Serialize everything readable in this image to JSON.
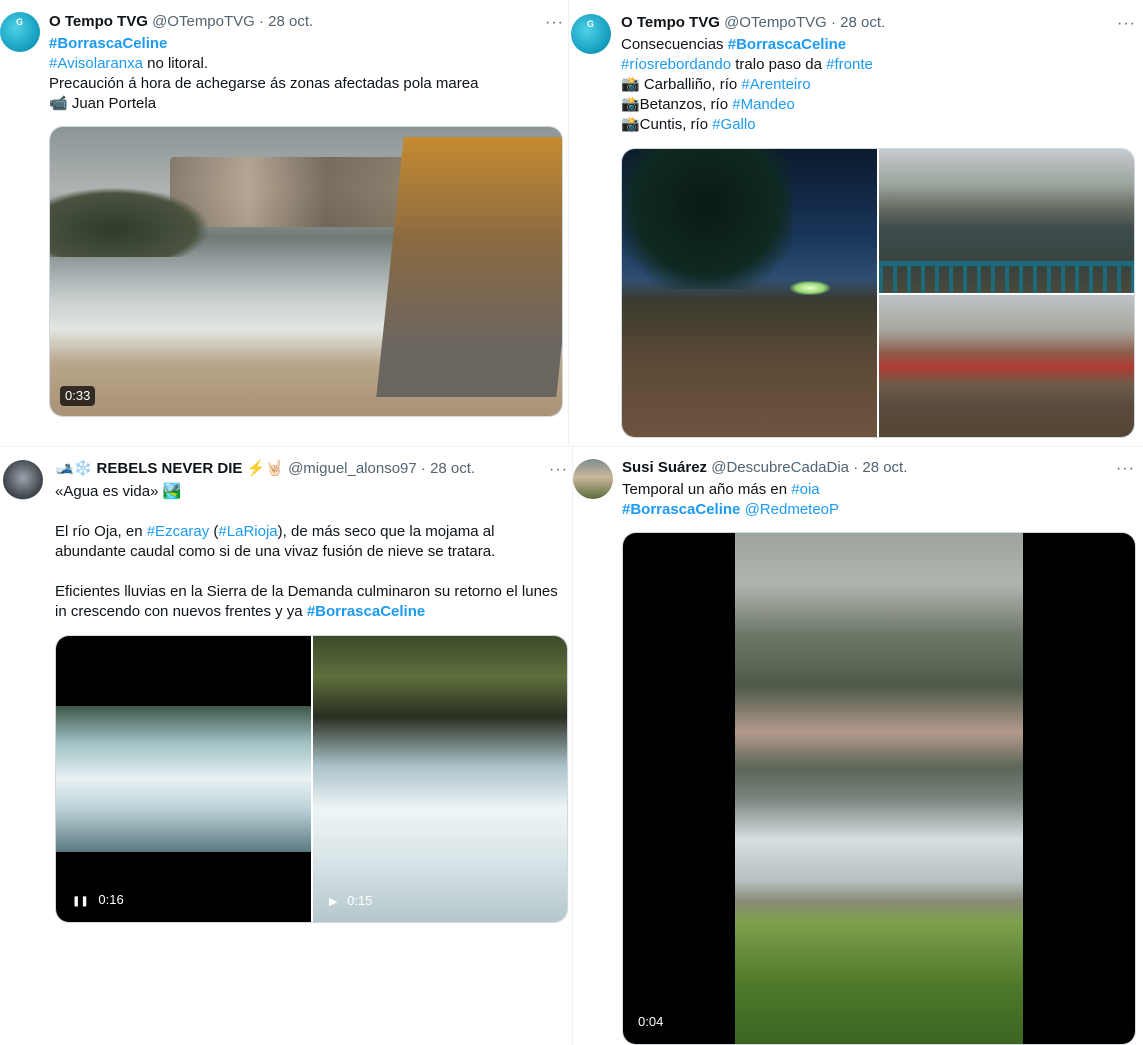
{
  "tweets": [
    {
      "name": "O Tempo TVG",
      "handle": "@OTempoTVG",
      "date": "· 28 oct.",
      "more": "···",
      "lines": [
        [
          {
            "t": "#BorrascaCeline",
            "k": "tagb"
          }
        ],
        [
          {
            "t": "#Avisolaranxa",
            "k": "tag"
          },
          {
            "t": " no litoral.",
            "k": "txt"
          }
        ],
        [
          {
            "t": "Precaución á hora de achegarse ás zonas afectadas pola marea",
            "k": "txt"
          }
        ],
        [
          {
            "t": "📹 Juan Portela",
            "k": "txt"
          }
        ]
      ],
      "media_duration": "0:33",
      "avatar_text": "G"
    },
    {
      "name": "O Tempo TVG",
      "handle": "@OTempoTVG",
      "date": "· 28 oct.",
      "more": "···",
      "lines": [
        [
          {
            "t": "Consecuencias ",
            "k": "txt"
          },
          {
            "t": "#BorrascaCeline",
            "k": "tagb"
          }
        ],
        [
          {
            "t": "#ríosrebordando",
            "k": "tag"
          },
          {
            "t": " tralo paso da ",
            "k": "txt"
          },
          {
            "t": "#fronte",
            "k": "tag"
          }
        ],
        [
          {
            "t": "📸 Carballiño, río ",
            "k": "txt"
          },
          {
            "t": "#Arenteiro",
            "k": "tag"
          }
        ],
        [
          {
            "t": "📸Betanzos, río ",
            "k": "txt"
          },
          {
            "t": "#Mandeo",
            "k": "tag"
          }
        ],
        [
          {
            "t": "📸Cuntis, río ",
            "k": "txt"
          },
          {
            "t": "#Gallo",
            "k": "tag"
          }
        ]
      ],
      "avatar_text": "G"
    },
    {
      "name": "🎿❄️ REBELS NEVER DIE ⚡🤘🏻",
      "handle": "@miguel_alonso97",
      "date": "· 28 oct.",
      "more": "···",
      "lines": [
        [
          {
            "t": "«Agua es vida» 🏞️",
            "k": "txt"
          }
        ],
        [
          {
            "t": "",
            "k": "txt"
          }
        ],
        [
          {
            "t": "El río Oja, en ",
            "k": "txt"
          },
          {
            "t": "#Ezcaray",
            "k": "tag"
          },
          {
            "t": " (",
            "k": "txt"
          },
          {
            "t": "#LaRioja",
            "k": "tag"
          },
          {
            "t": "), de más seco que la mojama al",
            "k": "txt"
          }
        ],
        [
          {
            "t": "abundante caudal como si de una vivaz fusión de nieve se tratara.",
            "k": "txt"
          }
        ],
        [
          {
            "t": "",
            "k": "txt"
          }
        ],
        [
          {
            "t": "Eficientes lluvias en la Sierra de la Demanda culminaron su retorno el lunes",
            "k": "txt"
          }
        ],
        [
          {
            "t": "in crescendo con nuevos frentes y ya ",
            "k": "txt"
          },
          {
            "t": "#BorrascaCeline",
            "k": "tagb"
          }
        ]
      ],
      "media_left_duration": "0:16",
      "media_right_duration": "0:15",
      "pause_glyph": "❚❚",
      "play_glyph": "▶"
    },
    {
      "name": "Susi Suárez",
      "handle": "@DescubreCadaDia",
      "date": "· 28 oct.",
      "more": "···",
      "lines": [
        [
          {
            "t": "Temporal un año más en ",
            "k": "txt"
          },
          {
            "t": "#oia",
            "k": "tag"
          }
        ],
        [
          {
            "t": "#BorrascaCeline",
            "k": "tagb"
          },
          {
            "t": " ",
            "k": "txt"
          },
          {
            "t": "@RedmeteoP",
            "k": "tag"
          }
        ]
      ],
      "media_duration": "0:04"
    }
  ]
}
